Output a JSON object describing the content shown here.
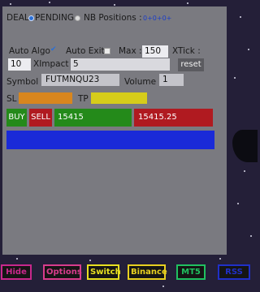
{
  "header": {
    "deal_label": "DEAL",
    "pending_label": "PENDING",
    "nb_positions_label": "NB Positions :",
    "nb_positions_value": "0+0+0+"
  },
  "settings": {
    "auto_algo_label": "Auto Algo",
    "auto_exit_label": "Auto Exit",
    "max_label": "Max :",
    "max_value": "150",
    "xtick_label": "XTick :",
    "xtick_value": "10",
    "ximpact_label": "XImpact :",
    "ximpact_value": "5",
    "reset_label": "reset"
  },
  "instrument": {
    "symbol_label": "Symbol",
    "symbol_value": "FUTMNQU23",
    "volume_label": "Volume",
    "volume_value": "1"
  },
  "levels": {
    "sl_label": "SL",
    "tp_label": "TP"
  },
  "trade": {
    "buy_label": "BUY",
    "sell_label": "SELL",
    "bid_price": "15415",
    "ask_price": "15415.25"
  },
  "bottom_bar": [
    {
      "label": "Hide",
      "color": "#c8288c"
    },
    {
      "label": "Options",
      "color": "#d83c8c"
    },
    {
      "label": "Switch",
      "color": "#e8e020"
    },
    {
      "label": "Binance",
      "color": "#e8d020"
    },
    {
      "label": "MT5",
      "color": "#20c060"
    },
    {
      "label": "RSS",
      "color": "#2030c8"
    }
  ],
  "colors": {
    "panel": "#7a7a80",
    "sl_fill": "#d8861e",
    "tp_fill": "#d6cc1a",
    "buy": "#248a1a",
    "sell": "#b01a20",
    "bar": "#1a2ad8",
    "accent": "#2a6fd6"
  }
}
